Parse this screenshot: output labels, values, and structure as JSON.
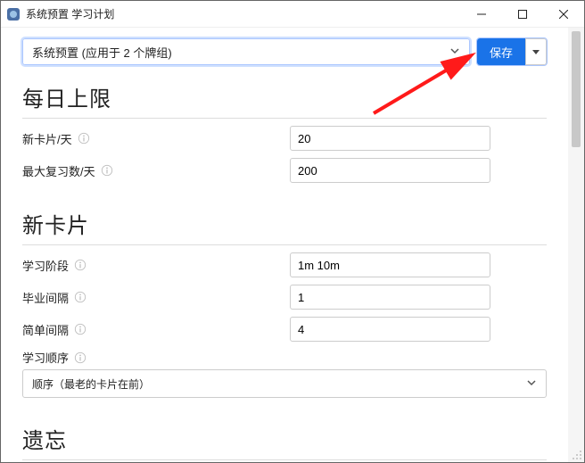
{
  "window": {
    "title": "系统预置 学习计划"
  },
  "top": {
    "preset_label": "系统预置 (应用于 2 个牌组)",
    "save_label": "保存"
  },
  "sections": {
    "daily_limits": {
      "heading": "每日上限",
      "new_cards_label": "新卡片/天",
      "new_cards_value": "20",
      "max_reviews_label": "最大复习数/天",
      "max_reviews_value": "200"
    },
    "new_cards": {
      "heading": "新卡片",
      "learning_steps_label": "学习阶段",
      "learning_steps_value": "1m 10m",
      "graduating_interval_label": "毕业间隔",
      "graduating_interval_value": "1",
      "easy_interval_label": "简单间隔",
      "easy_interval_value": "4",
      "insertion_order_label": "学习顺序",
      "insertion_order_value": "顺序（最老的卡片在前）"
    },
    "lapses": {
      "heading": "遗忘"
    }
  }
}
